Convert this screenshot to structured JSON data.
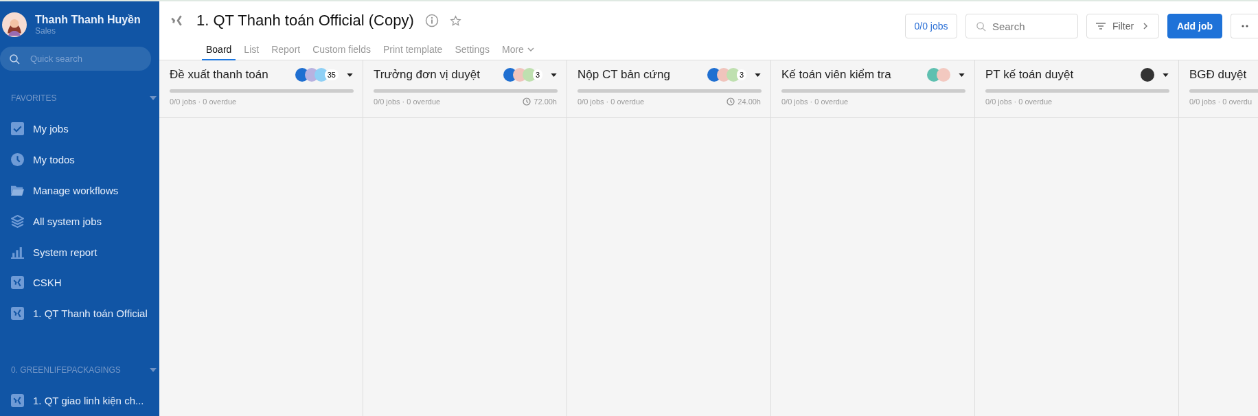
{
  "user": {
    "name": "Thanh Thanh Huyền",
    "role": "Sales"
  },
  "quick_search": {
    "placeholder": "Quick search"
  },
  "sidebar": {
    "sections": [
      {
        "title": "FAVORITES",
        "expanded": true,
        "items": [
          {
            "kind": "check",
            "label": "My jobs"
          },
          {
            "kind": "clock",
            "label": "My todos"
          },
          {
            "kind": "folder",
            "label": "Manage workflows"
          },
          {
            "kind": "layers",
            "label": "All system jobs"
          },
          {
            "kind": "chart",
            "label": "System report"
          },
          {
            "kind": "workflow",
            "label": "CSKH"
          },
          {
            "kind": "workflow",
            "label": "1. QT Thanh toán Official"
          }
        ]
      },
      {
        "title": "0. GREENLIFEPACKAGINGS",
        "expanded": true,
        "items": [
          {
            "kind": "workflow",
            "label": "1. QT giao linh kiện ch..."
          }
        ]
      }
    ]
  },
  "header": {
    "title": "1. QT Thanh toán Official (Copy)",
    "starred": false,
    "tabs": [
      {
        "label": "Board",
        "selected": true
      },
      {
        "label": "List",
        "selected": false
      },
      {
        "label": "Report",
        "selected": false
      },
      {
        "label": "Custom fields",
        "selected": false
      },
      {
        "label": "Print template",
        "selected": false
      },
      {
        "label": "Settings",
        "selected": false
      },
      {
        "label": "More",
        "selected": false
      }
    ],
    "jobs_count": "0/0 jobs",
    "search": {
      "placeholder": "Search"
    },
    "filter": "Filter",
    "add_button": "Add job"
  },
  "columns": [
    {
      "title": "Đề xuất thanh toán",
      "avatars": [
        {
          "color": "#1f6fd1"
        },
        {
          "color": "#b8b2e0"
        },
        {
          "color": "#8fd0f5"
        }
      ],
      "count": "35",
      "stats": "0/0 jobs · 0 overdue"
    },
    {
      "title": "Trưởng đơn vị duyệt",
      "avatars": [
        {
          "color": "#1f6fd1"
        },
        {
          "color": "#f0c4bc"
        },
        {
          "color": "#bfe0b0"
        }
      ],
      "count": "3",
      "stats": "0/0 jobs · 0 overdue",
      "duration": "72.00h"
    },
    {
      "title": "Nộp CT bản cứng",
      "avatars": [
        {
          "color": "#1f6fd1"
        },
        {
          "color": "#f0c4bc"
        },
        {
          "color": "#bfe0b0"
        }
      ],
      "count": "3",
      "stats": "0/0 jobs · 0 overdue",
      "duration": "24.00h"
    },
    {
      "title": "Kế toán viên kiểm tra",
      "avatars": [
        {
          "color": "#5fc0b0"
        },
        {
          "color": "#f3c9c0"
        }
      ],
      "stats": "0/0 jobs · 0 overdue"
    },
    {
      "title": "PT kế toán duyệt",
      "avatars": [
        {
          "color": "#333333"
        }
      ],
      "stats": "0/0 jobs · 0 overdue"
    },
    {
      "title": "BGĐ duyệt",
      "stats": "0/0 jobs · 0 overdu"
    }
  ]
}
